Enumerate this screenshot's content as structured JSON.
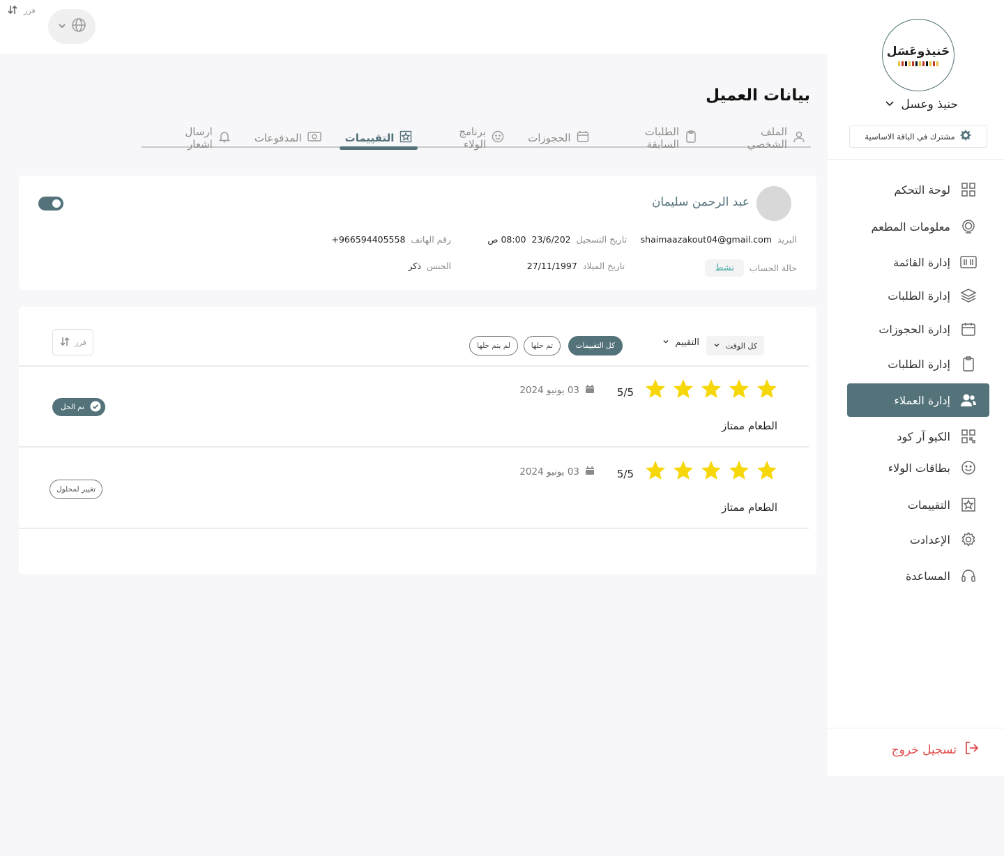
{
  "topbar": {
    "sort_label": "فرز"
  },
  "sidebar": {
    "logo_text": "حَنيذوعَسَل",
    "brand_name": "حنيذ وعسل",
    "plan": "مشترك في الباقة الاساسية",
    "items": [
      {
        "label": "لوحة التحكم",
        "icon": "grid-icon"
      },
      {
        "label": "معلومات المطعم",
        "icon": "restaurant-icon"
      },
      {
        "label": "إدارة القائمة",
        "icon": "menu-icon"
      },
      {
        "label": "إدارة الطلبات",
        "icon": "layers-icon"
      },
      {
        "label": "إدارة الحجوزات",
        "icon": "calendar-icon"
      },
      {
        "label": "إدارة الطلبات",
        "icon": "clipboard-icon"
      },
      {
        "label": "إدارة العملاء",
        "icon": "users-icon",
        "active": true
      },
      {
        "label": "الكيو آر كود",
        "icon": "qr-icon"
      },
      {
        "label": "بطاقات الولاء",
        "icon": "smile-icon"
      },
      {
        "label": "التقييمات",
        "icon": "star-frame-icon"
      },
      {
        "label": "الإعدادت",
        "icon": "gear-icon"
      },
      {
        "label": "المساعدة",
        "icon": "headset-icon"
      }
    ],
    "logout": "تسجيل خروج"
  },
  "page": {
    "title": "بيانات العميل",
    "tabs": [
      {
        "label": "الملف الشخصي",
        "icon": "user-icon"
      },
      {
        "label": "الطلبات السابقة",
        "icon": "clipboard-icon"
      },
      {
        "label": "الحجوزات",
        "icon": "calendar-icon"
      },
      {
        "label": "برنامج الولاء",
        "icon": "smile-icon"
      },
      {
        "label": "التقييمات",
        "icon": "star-frame-icon",
        "active": true
      },
      {
        "label": "المدفوعات",
        "icon": "cash-icon"
      },
      {
        "label": "ارسال اشعار",
        "icon": "bell-icon"
      }
    ]
  },
  "customer": {
    "name": "عبد الرحمن سليمان",
    "email_label": "البريد",
    "email": "shaimaazakout04@gmail.com",
    "reg_label": "تاريخ التسجيل",
    "reg_date": "23/6/202",
    "reg_time": "08:00 ص",
    "phone_label": "رقم الهاتف",
    "phone": "+966594405558",
    "status_label": "حالة الحساب",
    "status": "نشط",
    "birth_label": "تاريخ الميلاد",
    "birth": "27/11/1997",
    "gender_label": "الجنس",
    "gender": "ذكر",
    "active": true
  },
  "filters": {
    "time": "كل الوقت",
    "rating": "التقييم",
    "chips": [
      "كل التقييمات",
      "تم حلها",
      "لم يتم حلها"
    ],
    "sort": "فرز"
  },
  "reviews": [
    {
      "rating": 5,
      "score": "5/5",
      "date": "03 يونيو 2024",
      "text": "الطعام ممتاز",
      "action": "تم الحل",
      "resolved": true
    },
    {
      "rating": 5,
      "score": "5/5",
      "date": "03 يونيو 2024",
      "text": "الطعام ممتاز",
      "action": "تغيير لمحلول",
      "resolved": false
    }
  ],
  "colors": {
    "accent": "#53727a",
    "star": "#f5d70a",
    "logout": "#e24a4a",
    "status": "#3aa7a0"
  }
}
